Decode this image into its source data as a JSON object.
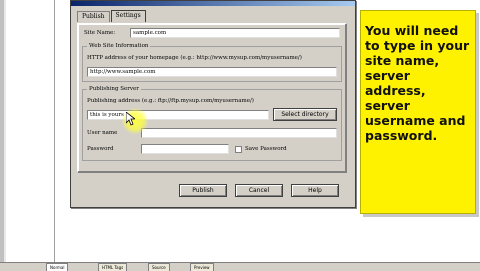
{
  "dialog": {
    "tabs": [
      {
        "label": "Publish",
        "active": false
      },
      {
        "label": "Settings",
        "active": true
      }
    ],
    "site_name_label": "Site Name:",
    "site_name_value": "sample.com",
    "web_site_group": {
      "title": "Web Site Information",
      "hint": "HTTP address of your homepage (e.g.: http://www.mysup.com/myusername/)",
      "url_value": "http://www.sample.com"
    },
    "publishing_group": {
      "title": "Publishing Server",
      "hint": "Publishing address (e.g.: ftp://ftp.mysup.com/myusername/)",
      "address_value": "this is yours"
    },
    "select_directory_label": "Select directory",
    "user_name_label": "User name",
    "password_label": "Password",
    "save_password_label": "Save Password",
    "buttons": {
      "publish": "Publish",
      "cancel": "Cancel",
      "help": "Help"
    }
  },
  "callout": {
    "text": "You will need to type in your site name, server address, server username and password."
  },
  "bottom_tabs": [
    {
      "label": "Normal",
      "active": true
    },
    {
      "label": "HTML Tags",
      "active": false
    },
    {
      "label": "Source",
      "active": false
    },
    {
      "label": "Preview",
      "active": false
    }
  ],
  "colors": {
    "callout_bg": "#fff200",
    "dialog_bg": "#d4d0c8",
    "titlebar": "#0a246a"
  }
}
